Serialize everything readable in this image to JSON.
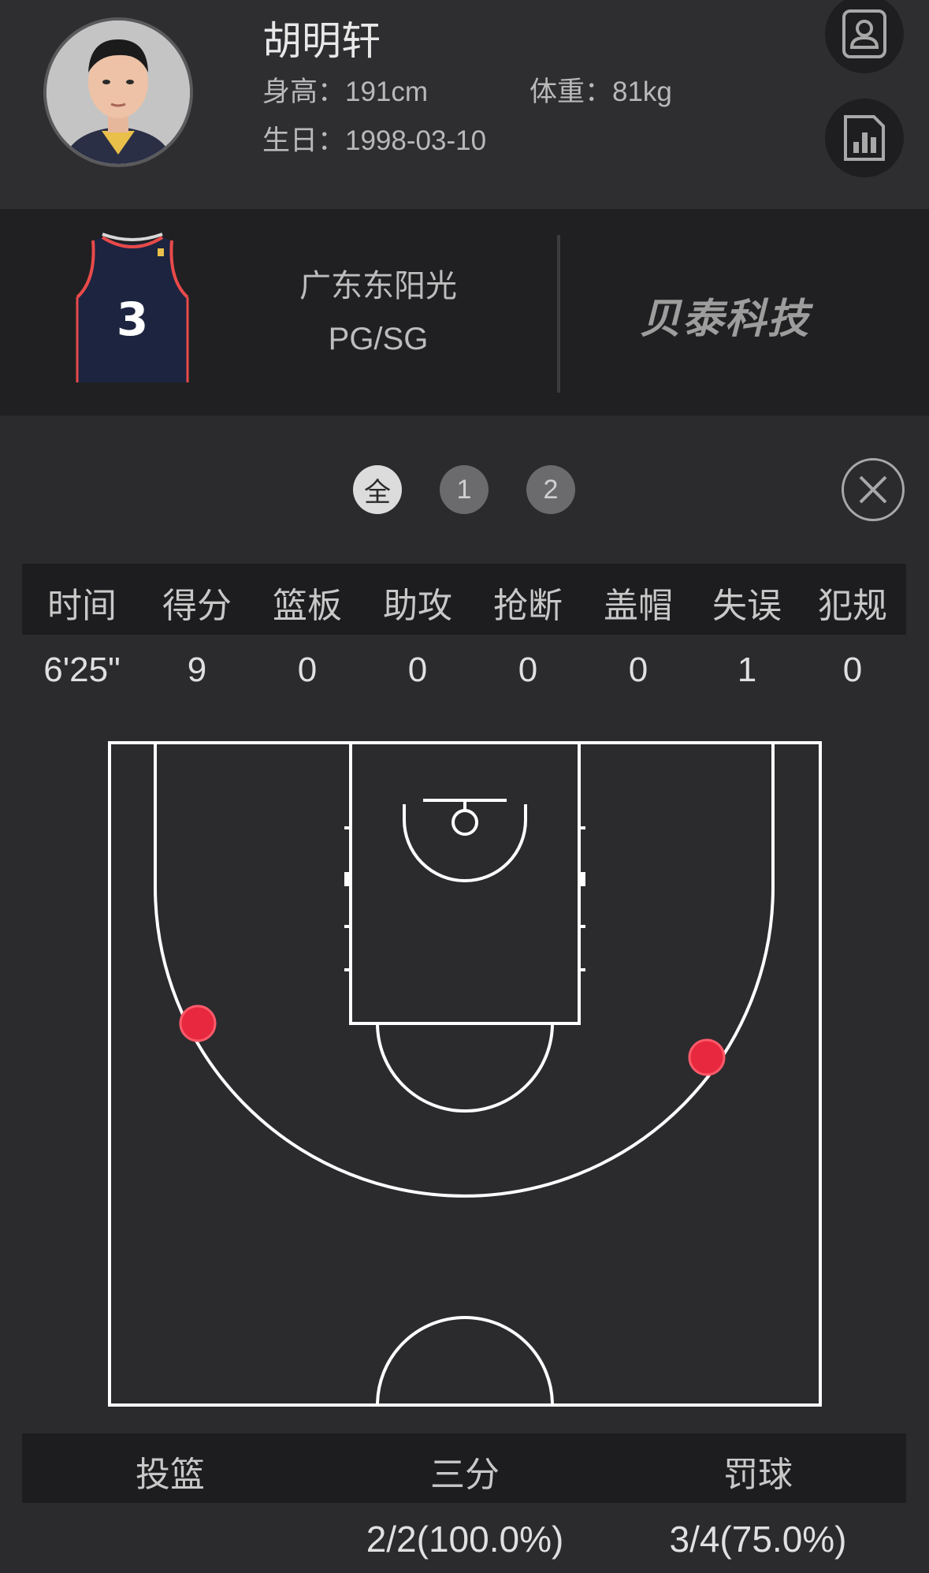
{
  "player": {
    "name": "胡明轩",
    "height": "身高：191cm",
    "weight": "体重：81kg",
    "birthday": "生日：1998-03-10"
  },
  "team": {
    "jersey_number": "3",
    "name": "广东东阳光",
    "position": "PG/SG",
    "sponsor": "贝泰科技"
  },
  "periods": [
    {
      "label": "全",
      "active": true
    },
    {
      "label": "1",
      "active": false
    },
    {
      "label": "2",
      "active": false
    }
  ],
  "stats": {
    "headers": [
      "时间",
      "得分",
      "篮板",
      "助攻",
      "抢断",
      "盖帽",
      "失误",
      "犯规"
    ],
    "values": [
      "6'25\"",
      "9",
      "0",
      "0",
      "0",
      "0",
      "1",
      "0"
    ]
  },
  "shooting": {
    "headers": [
      "投篮",
      "三分",
      "罚球"
    ],
    "values": [
      "",
      "2/2(100.0%)",
      "3/4(75.0%)"
    ]
  },
  "colors": {
    "background": "#2b2b2e",
    "shot_made": "#e8283e",
    "court_line": "#ffffff"
  },
  "icons": {
    "profile": "contact-card-icon",
    "stats": "bar-chart-icon",
    "close": "close-icon"
  }
}
